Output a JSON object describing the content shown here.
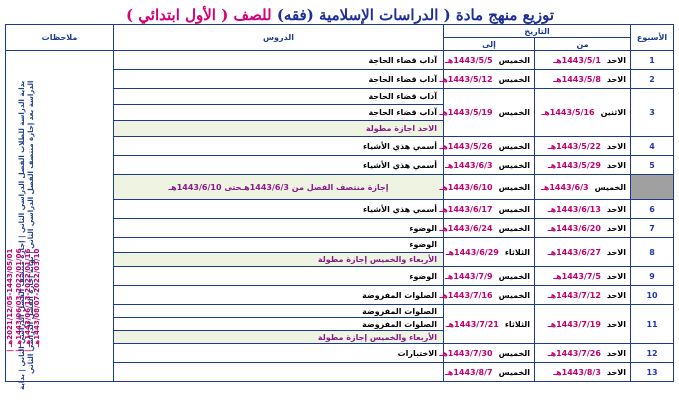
{
  "title": {
    "main": "توزيع منهج مادة ( الدراسات الإسلامية (فقه) ",
    "grade": "للصف ( الأول ابتدائي )"
  },
  "headers": {
    "week": "الأسبوع",
    "date": "التاريخ",
    "from": "من",
    "to": "إلى",
    "lessons": "الدروس",
    "notes": "ملاحظات"
  },
  "rows": [
    {
      "week": "1",
      "from_day": "الاحد",
      "from": "1443/5/1هـ",
      "to_day": "الخميس",
      "to": "1443/5/5هـ",
      "lessons": [
        "آداب قضاء الحاجة"
      ]
    },
    {
      "week": "2",
      "from_day": "الاحد",
      "from": "1443/5/8هـ",
      "to_day": "الخميس",
      "to": "1443/5/12هـ",
      "lessons": [
        "آداب قضاء الحاجة"
      ]
    },
    {
      "week": "3",
      "from_day": "الاثنين",
      "from": "1443/5/16هـ",
      "to_day": "الخميس",
      "to": "1443/5/19هـ",
      "lessons": [
        "آداب قضاء الحاجة",
        "آداب قضاء الحاجة"
      ],
      "holiday": "الاحد اجازة مطولة"
    },
    {
      "week": "4",
      "from_day": "الاحد",
      "from": "1443/5/22هـ",
      "to_day": "الخميس",
      "to": "1443/5/26هـ",
      "lessons": [
        "أسمي هذي الأشياء"
      ]
    },
    {
      "week": "5",
      "from_day": "الاحد",
      "from": "1443/5/29هـ",
      "to_day": "الخميس",
      "to": "1443/6/3هـ",
      "lessons": [
        "أسمي هذي الأشياء"
      ]
    },
    {
      "week": "",
      "from_day": "الخميس",
      "from": "1443/6/3هـ",
      "to_day": "الخميس",
      "to": "1443/6/10هـ",
      "midterm": "إجازة منتصف الفصل من 1443/6/3هـحتى 1443/6/10هـ"
    },
    {
      "week": "6",
      "from_day": "الاحد",
      "from": "1443/6/13هـ",
      "to_day": "الخميس",
      "to": "1443/6/17هـ",
      "lessons": [
        "أسمي هذي الأشياء"
      ]
    },
    {
      "week": "7",
      "from_day": "الاحد",
      "from": "1443/6/20هـ",
      "to_day": "الخميس",
      "to": "1443/6/24هـ",
      "lessons": [
        "الوضوء"
      ]
    },
    {
      "week": "8",
      "from_day": "الاحد",
      "from": "1443/6/27هـ",
      "to_day": "الثلاثاء",
      "to": "1443/6/29هـ",
      "lessons": [
        "الوضوء"
      ],
      "holiday": "الأربعاء والخميس إجازة مطولة"
    },
    {
      "week": "9",
      "from_day": "الاحد",
      "from": "1443/7/5هـ",
      "to_day": "الخميس",
      "to": "1443/7/9هـ",
      "lessons": [
        "الوضوء"
      ]
    },
    {
      "week": "10",
      "from_day": "الاحد",
      "from": "1443/7/12هـ",
      "to_day": "الخميس",
      "to": "1443/7/16هـ",
      "lessons": [
        "الصلوات المفروضة"
      ]
    },
    {
      "week": "11",
      "from_day": "الاحد",
      "from": "1443/7/19هـ",
      "to_day": "الثلاثاء",
      "to": "1443/7/21هـ",
      "lessons": [
        "الصلوات المفروضة",
        "الصلوات المفروضة"
      ],
      "holiday": "الأربعاء والخميس إجازة مطولة"
    },
    {
      "week": "12",
      "from_day": "الاحد",
      "from": "1443/7/26هـ",
      "to_day": "الخميس",
      "to": "1443/7/30هـ",
      "lessons": [
        "الاختبارات"
      ]
    },
    {
      "week": "13",
      "from_day": "الاحد",
      "from": "1443/8/3هـ",
      "to_day": "الخميس",
      "to": "1443/8/7هـ",
      "lessons": []
    }
  ],
  "notes": {
    "text": "بداية الدراسة للطلاب الفصل الدراسي الثاني | إجازة منتصف الفصل الدراسي الثاني | بداية الدراسة بعد إجازة منتصف الفصل الدراسي الثاني | نهاية إجازة الفصل الدراسي الثاني",
    "dates": "2021/12/05-1443/05/01هـ | 2022/01/06-1443/06/03هـ | 2022/01/16-1443/06/13هـ | 2022/03/10-1443/08/07هـ"
  }
}
